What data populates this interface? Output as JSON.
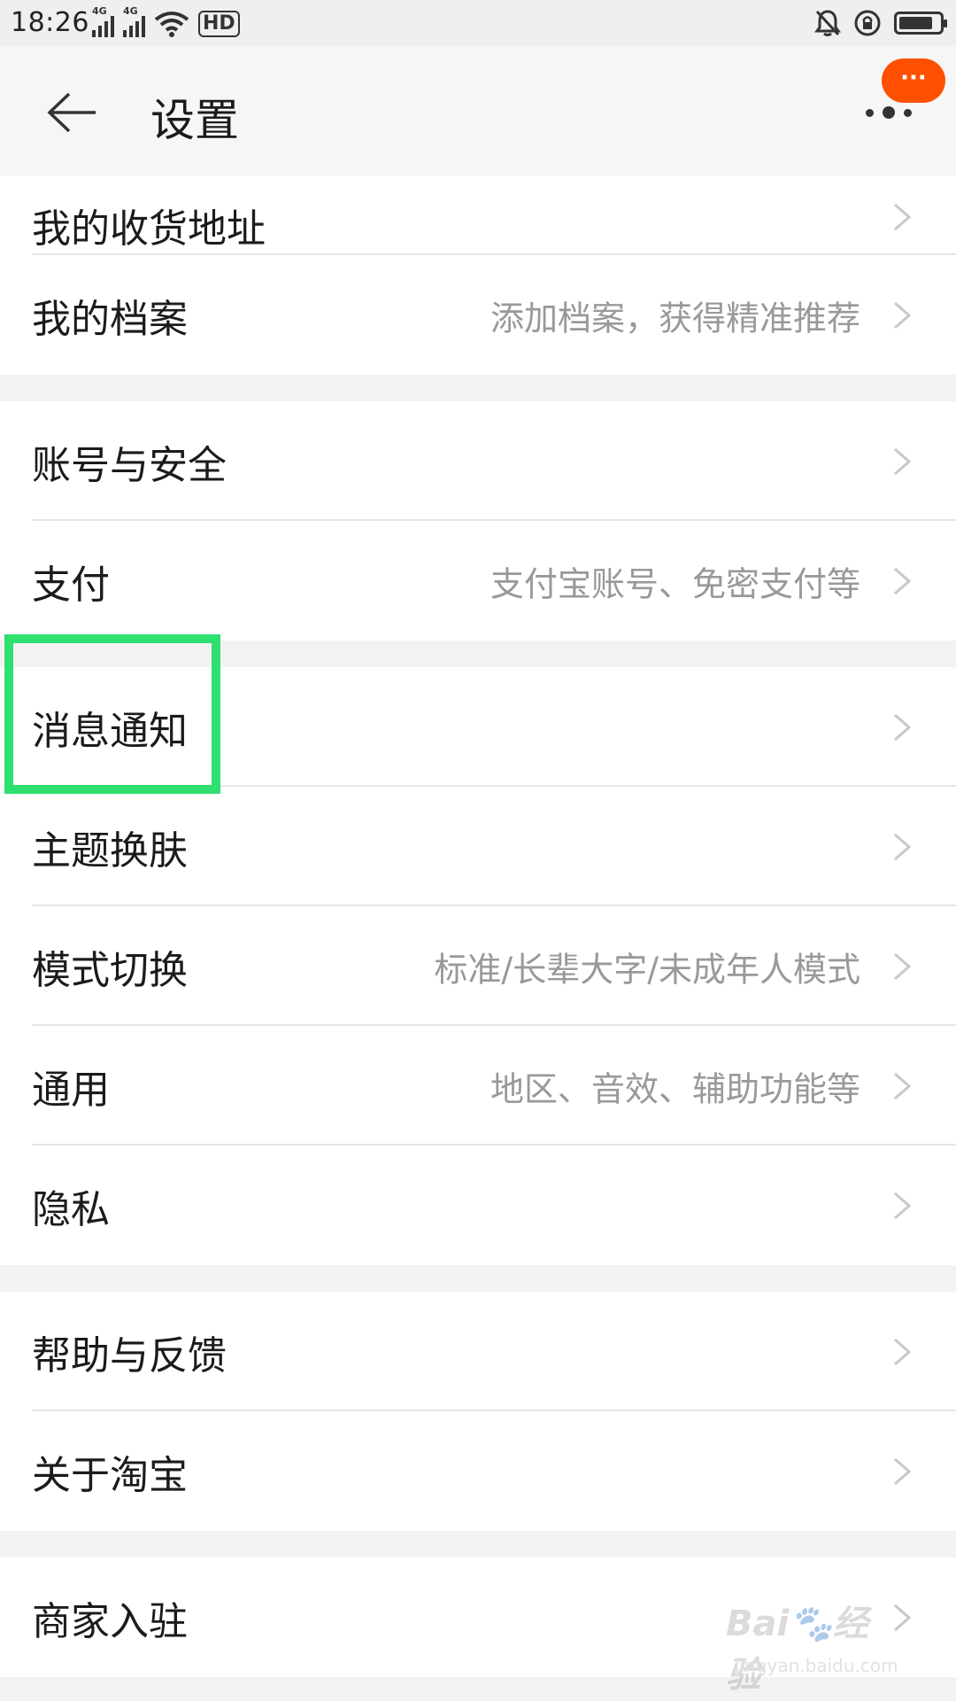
{
  "status_bar": {
    "time": "18:26",
    "network1": "4G",
    "network2": "4G",
    "hd_label": "HD",
    "battery_level_percent": 85
  },
  "header": {
    "title": "设置",
    "badge": "···",
    "icons": {
      "back": "back-arrow-icon",
      "more": "more-dots-icon"
    }
  },
  "settings": {
    "groups": [
      {
        "items": [
          {
            "label": "我的收货地址",
            "sub": ""
          },
          {
            "label": "我的档案",
            "sub": "添加档案，获得精准推荐"
          }
        ]
      },
      {
        "items": [
          {
            "label": "账号与安全",
            "sub": ""
          },
          {
            "label": "支付",
            "sub": "支付宝账号、免密支付等"
          }
        ]
      },
      {
        "items": [
          {
            "label": "消息通知",
            "sub": ""
          },
          {
            "label": "主题换肤",
            "sub": ""
          },
          {
            "label": "模式切换",
            "sub": "标准/长辈大字/未成年人模式"
          },
          {
            "label": "通用",
            "sub": "地区、音效、辅助功能等"
          },
          {
            "label": "隐私",
            "sub": ""
          }
        ]
      },
      {
        "items": [
          {
            "label": "帮助与反馈",
            "sub": ""
          },
          {
            "label": "关于淘宝",
            "sub": ""
          }
        ]
      },
      {
        "items": [
          {
            "label": "商家入驻",
            "sub": ""
          }
        ]
      }
    ]
  },
  "watermark": {
    "brand": "Bai",
    "brand2": "经验",
    "url": "jingyan.baidu.com"
  },
  "colors": {
    "accent": "#fe5000",
    "highlight": "#2fe070",
    "text_primary": "#1b1b1b",
    "text_secondary": "#999999"
  }
}
